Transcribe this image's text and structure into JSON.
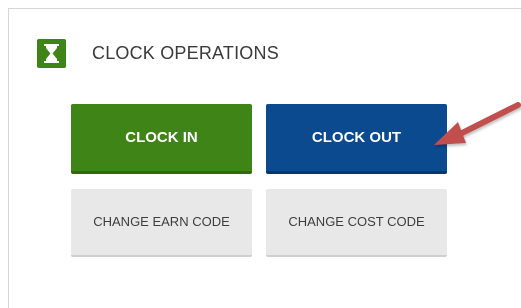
{
  "panel": {
    "title": "CLOCK OPERATIONS",
    "icon": "hourglass-icon",
    "accent_color": "#3f8417"
  },
  "buttons": {
    "clock_in": {
      "label": "CLOCK IN",
      "color": "#3f8417"
    },
    "clock_out": {
      "label": "CLOCK OUT",
      "color": "#0b4a8e"
    },
    "change_earn_code": {
      "label": "CHANGE EARN CODE"
    },
    "change_cost_code": {
      "label": "CHANGE COST CODE"
    }
  },
  "annotation": {
    "icon": "arrow-pointer-icon",
    "color": "#c0504d"
  }
}
